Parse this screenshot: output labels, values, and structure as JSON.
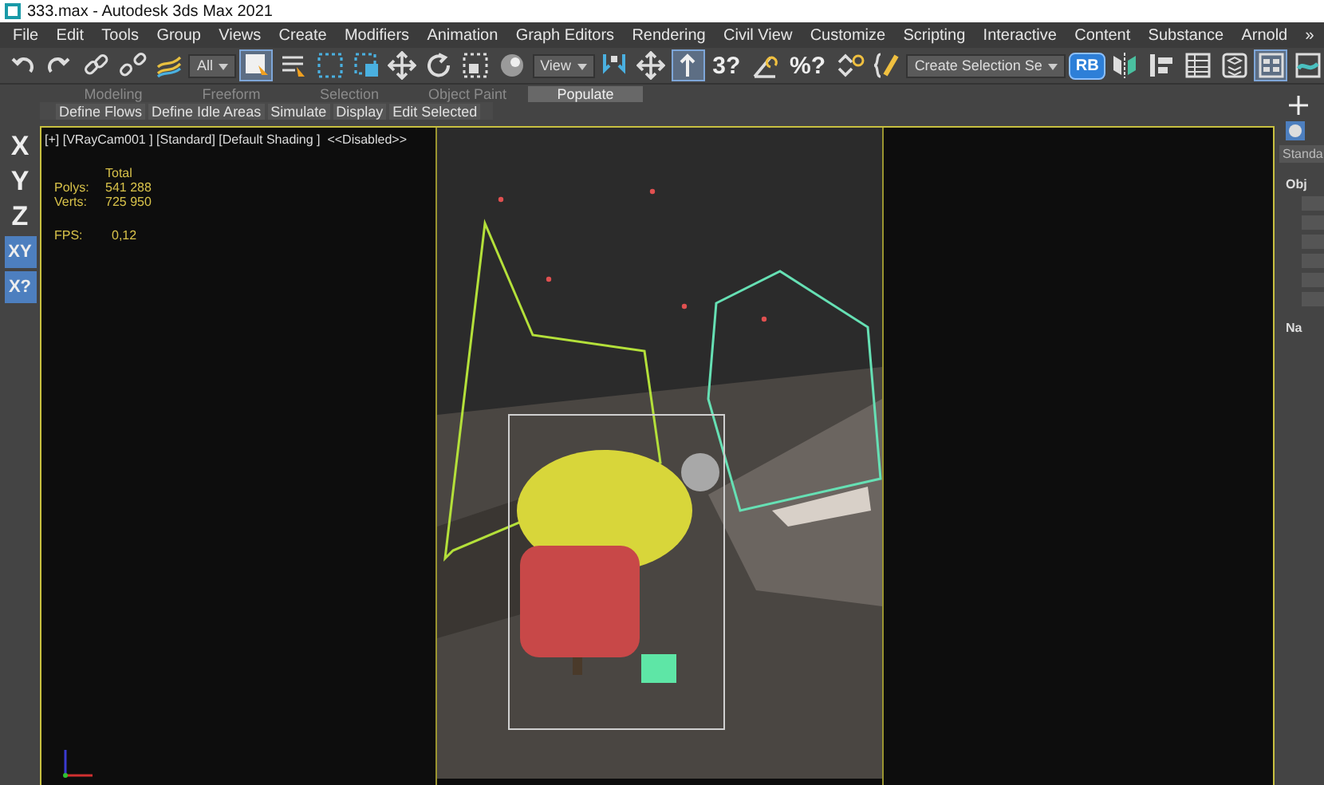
{
  "window": {
    "title": "333.max - Autodesk 3ds Max 2021"
  },
  "menu": [
    "File",
    "Edit",
    "Tools",
    "Group",
    "Views",
    "Create",
    "Modifiers",
    "Animation",
    "Graph Editors",
    "Rendering",
    "Civil View",
    "Customize",
    "Scripting",
    "Interactive",
    "Content",
    "Substance",
    "Arnold",
    "»"
  ],
  "toolbar": [
    {
      "kind": "undo"
    },
    {
      "kind": "redo"
    },
    {
      "kind": "link"
    },
    {
      "kind": "unlink"
    },
    {
      "kind": "bind"
    },
    {
      "kind": "dropdown",
      "text": "All"
    },
    {
      "kind": "select",
      "on": true
    },
    {
      "kind": "select-list"
    },
    {
      "kind": "region"
    },
    {
      "kind": "crossing"
    },
    {
      "kind": "move"
    },
    {
      "kind": "rotate"
    },
    {
      "kind": "scale"
    },
    {
      "kind": "placement"
    },
    {
      "kind": "dropdown",
      "text": "View"
    },
    {
      "kind": "pivot"
    },
    {
      "kind": "move"
    },
    {
      "kind": "manipulate",
      "on": true
    },
    {
      "kind": "glyph",
      "text": "3?"
    },
    {
      "kind": "angle"
    },
    {
      "kind": "glyph",
      "text": "%?"
    },
    {
      "kind": "spinner"
    },
    {
      "kind": "named"
    },
    {
      "kind": "dropdown",
      "text": "Create Selection Se"
    },
    {
      "kind": "badge",
      "text": "RB"
    },
    {
      "kind": "mirror"
    },
    {
      "kind": "align"
    },
    {
      "kind": "table"
    },
    {
      "kind": "layers"
    },
    {
      "kind": "panel",
      "on": true
    },
    {
      "kind": "render"
    }
  ],
  "ribbon": {
    "tabs": [
      {
        "label": "Modeling",
        "selected": false
      },
      {
        "label": "Freeform",
        "selected": false
      },
      {
        "label": "Selection",
        "selected": false
      },
      {
        "label": "Object Paint",
        "selected": false
      },
      {
        "label": "Populate",
        "selected": true
      }
    ],
    "buttons": [
      "Define Flows",
      "Define Idle Areas",
      "Simulate",
      "Display",
      "Edit Selected"
    ]
  },
  "axis_constraints": [
    {
      "label": "X",
      "selected": false
    },
    {
      "label": "Y",
      "selected": false
    },
    {
      "label": "Z",
      "selected": false
    },
    {
      "label": "XY",
      "selected": true
    },
    {
      "label": "X?",
      "selected": true
    }
  ],
  "viewport": {
    "label": "[+] [VRayCam001 ] [Standard] [Default Shading ]  <<Disabled>>",
    "stats": {
      "heading": "Total",
      "rows": [
        {
          "name": "Polys:",
          "value": "541 288"
        },
        {
          "name": "Verts:",
          "value": "725 950"
        }
      ],
      "fps_label": "FPS:",
      "fps": "0,12"
    }
  },
  "command_panel": {
    "dropdown": "Standa",
    "sections": [
      "Obj",
      "Na"
    ]
  }
}
